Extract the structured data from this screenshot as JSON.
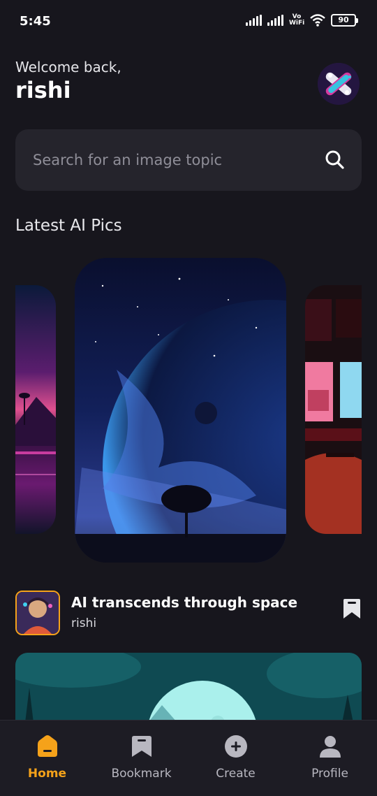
{
  "status_bar": {
    "time": "5:45",
    "network_label": "Vo WiFi",
    "battery": "90"
  },
  "header": {
    "welcome": "Welcome back,",
    "username": "rishi",
    "avatar_icon": "crossed-tools-avatar-icon"
  },
  "search": {
    "placeholder": "Search for an image topic",
    "value": "",
    "icon": "search-icon"
  },
  "section": {
    "title": "Latest AI Pics"
  },
  "post": {
    "title": "AI transcends through space",
    "author": "rishi",
    "bookmark_icon": "bookmark-icon"
  },
  "nav": {
    "items": [
      {
        "label": "Home",
        "icon": "home-icon",
        "active": true
      },
      {
        "label": "Bookmark",
        "icon": "bookmark-icon",
        "active": false
      },
      {
        "label": "Create",
        "icon": "plus-circle-icon",
        "active": false
      },
      {
        "label": "Profile",
        "icon": "user-icon",
        "active": false
      }
    ]
  },
  "colors": {
    "background": "#17161d",
    "surface": "#25242c",
    "accent": "#f5a21a",
    "nav_inactive": "#b8b7c0"
  }
}
